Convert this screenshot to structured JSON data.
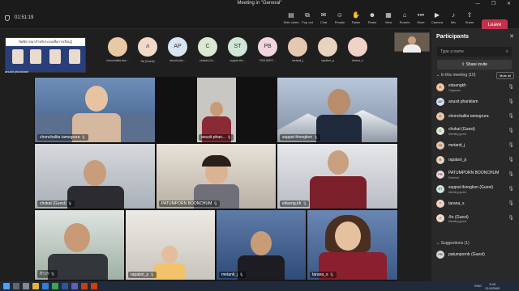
{
  "window": {
    "title": "Meeting in \"General\"",
    "controls": "— ❐ ✕"
  },
  "toolbar": {
    "timer": "01:51:19",
    "buttons": [
      {
        "label": "Side notes",
        "icon": "notes-icon",
        "glyph": "▤"
      },
      {
        "label": "Pop out",
        "icon": "popout-icon",
        "glyph": "⧉"
      },
      {
        "label": "Chat",
        "icon": "chat-icon",
        "glyph": "✉"
      },
      {
        "label": "People",
        "icon": "people-icon",
        "glyph": "☺"
      },
      {
        "label": "Raise",
        "icon": "raise-hand-icon",
        "glyph": "✋"
      },
      {
        "label": "React",
        "icon": "react-icon",
        "glyph": "☻"
      },
      {
        "label": "View",
        "icon": "view-icon",
        "glyph": "▦"
      },
      {
        "label": "Rooms",
        "icon": "rooms-icon",
        "glyph": "⌂"
      },
      {
        "label": "More",
        "icon": "more-icon",
        "glyph": "•••"
      },
      {
        "label": "Camera",
        "icon": "camera-icon",
        "glyph": "▶"
      },
      {
        "label": "Mic",
        "icon": "mic-icon",
        "glyph": "♪"
      },
      {
        "label": "Share",
        "icon": "share-icon",
        "glyph": "⇪"
      }
    ],
    "leave_label": "Leave"
  },
  "content_share": {
    "banner": "ข้อพิจารณาสำหรับระบบเพื่อการเรียนรู้",
    "presenter": "anusit phanklam"
  },
  "gallery": [
    {
      "initials": "",
      "label": "chonchalita tam...",
      "color": "#e8c9a6"
    },
    {
      "initials": "ภ",
      "label": "ภัค (Guest)",
      "color": "#f0d9c8"
    },
    {
      "initials": "AP",
      "label": "anusit pha...",
      "color": "#d7e6f2"
    },
    {
      "initials": "C",
      "label": "chokat (Gu...",
      "color": "#dce8d0"
    },
    {
      "initials": "ST",
      "label": "suppat tho...",
      "color": "#cfe6d8"
    },
    {
      "initials": "PB",
      "label": "PATUMPO...",
      "color": "#f2d6de"
    },
    {
      "initials": "",
      "label": "metanit_j",
      "color": "#e4c8b0"
    },
    {
      "initials": "",
      "label": "rapatsri_p",
      "color": "#e9d2be"
    },
    {
      "initials": "",
      "label": "tarana_s",
      "color": "#f0d2c6"
    }
  ],
  "tiles": [
    {
      "name": "chonchalita tamegrura"
    },
    {
      "name": "anusit phan..."
    },
    {
      "name": "suppat thongkon"
    },
    {
      "name": "chokat (Guest)"
    },
    {
      "name": "PATUMPORN BOONCHUM"
    },
    {
      "name": "edueng.kh"
    },
    {
      "name": "ก้าวฯ"
    },
    {
      "name": "rapatsri_p"
    },
    {
      "name": "metanit_j"
    },
    {
      "name": "tarana_s"
    }
  ],
  "panel": {
    "title": "Participants",
    "search_placeholder": "Type a name",
    "share_invite": "Share invite",
    "in_meeting": "In this meeting (10)",
    "mute_all": "Mute all",
    "suggestions": "Suggestions (1)",
    "participants": [
      {
        "name": "eduengkh",
        "role": "Organizer",
        "initials": "E",
        "color": "#f2c6a0"
      },
      {
        "name": "anusit phanklam",
        "role": "",
        "initials": "AP",
        "color": "#cfe0f0"
      },
      {
        "name": "chonchalita tamegrura",
        "role": "",
        "initials": "C",
        "color": "#e8c9a6"
      },
      {
        "name": "chokat (Guest)",
        "role": "Meeting guest",
        "initials": "C",
        "color": "#dce8d0"
      },
      {
        "name": "metanit_j",
        "role": "",
        "initials": "M",
        "color": "#e4c8b0"
      },
      {
        "name": "rapatsri_p",
        "role": "",
        "initials": "R",
        "color": "#e9d2be"
      },
      {
        "name": "PATUMPORN BOONCHUM",
        "role": "External",
        "initials": "PB",
        "color": "#f2d6de"
      },
      {
        "name": "suppat thongkon (Guest)",
        "role": "Meeting guest",
        "initials": "ST",
        "color": "#cfe6d8"
      },
      {
        "name": "tarana_s",
        "role": "",
        "initials": "T",
        "color": "#f0d2c6"
      },
      {
        "name": "ภัค (Guest)",
        "role": "Meeting guest",
        "initials": "ภ",
        "color": "#f0d9c8"
      }
    ],
    "suggested": {
      "name": "patumpornb (Guest)",
      "initials": "PB",
      "color": "#d7d7d7"
    }
  },
  "taskbar": {
    "lang": "ENG",
    "time": "9:45",
    "date": "21/4/2565"
  }
}
